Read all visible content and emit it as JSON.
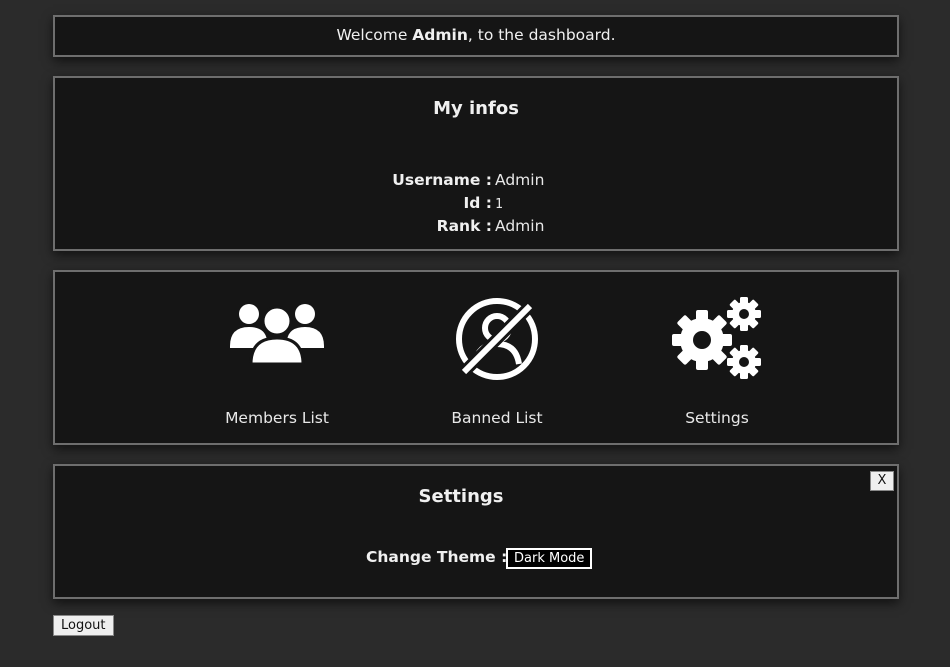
{
  "welcome": {
    "prefix": "Welcome ",
    "username": "Admin",
    "suffix": ", to the dashboard."
  },
  "infos": {
    "title": "My infos",
    "rows": [
      {
        "label": "Username :",
        "value": "Admin"
      },
      {
        "label": "Id :",
        "value": "1"
      },
      {
        "label": "Rank :",
        "value": "Admin"
      }
    ]
  },
  "links": [
    {
      "label": "Members List",
      "icon": "users-icon"
    },
    {
      "label": "Banned List",
      "icon": "banned-user-icon"
    },
    {
      "label": "Settings",
      "icon": "gears-icon"
    }
  ],
  "settings": {
    "title": "Settings",
    "close_label": "X",
    "theme_label": "Change Theme :",
    "theme_button": "Dark Mode"
  },
  "logout_label": "Logout"
}
